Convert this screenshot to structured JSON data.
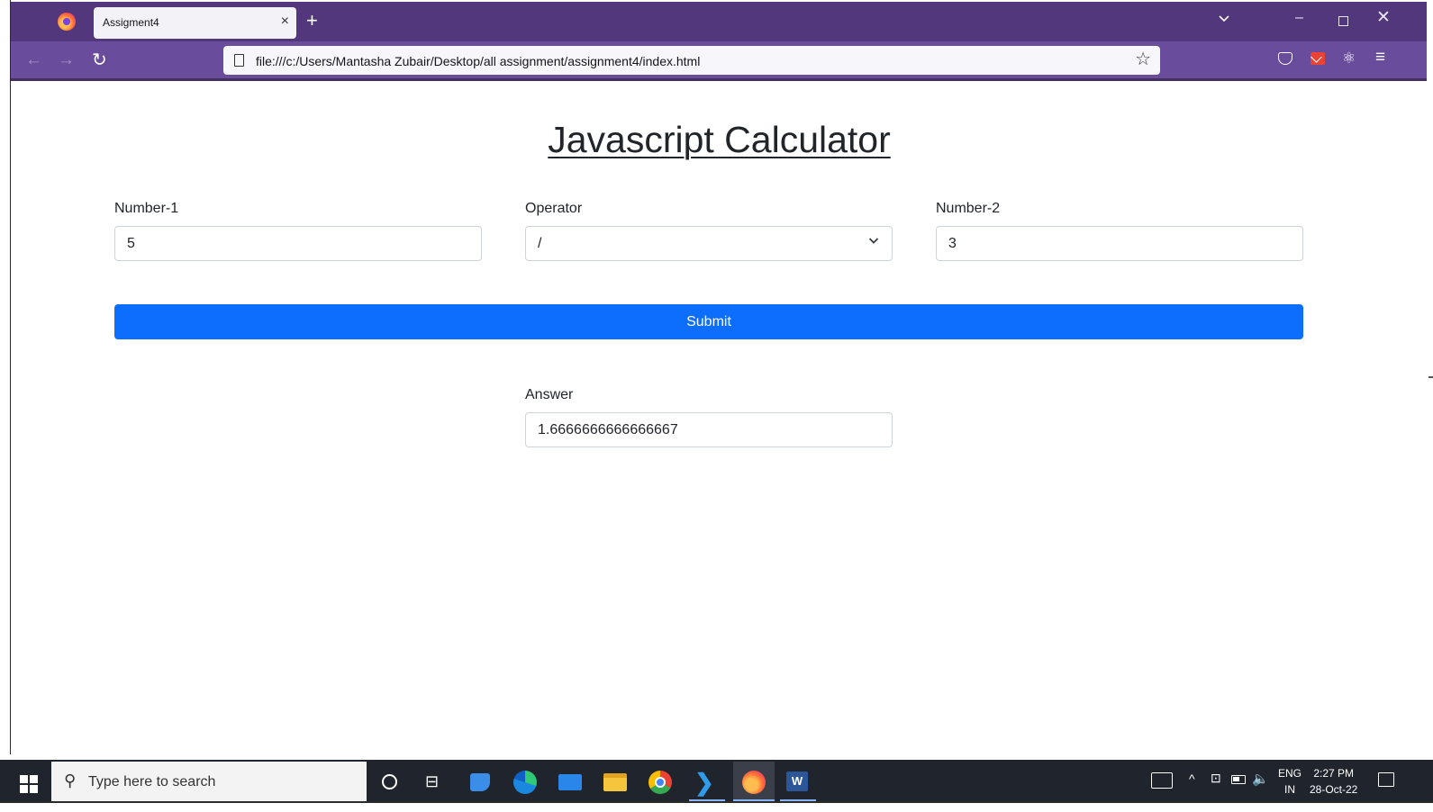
{
  "browser": {
    "tab_title": "Assigment4",
    "tab_close": "×",
    "new_tab": "+",
    "url": "file:///c:/Users/Mantasha Zubair/Desktop/all assignment/assignment4/index.html",
    "icons": [
      "firefox-icon",
      "back-arrow-icon",
      "forward-arrow-icon",
      "reload-icon",
      "page-icon",
      "bookmark-star-icon",
      "pocket-icon",
      "gmail-icon",
      "react-devtools-icon",
      "hamburger-menu-icon"
    ]
  },
  "page": {
    "title": "Javascript Calculator",
    "number1": {
      "label": "Number-1",
      "value": "5"
    },
    "operator": {
      "label": "Operator",
      "value": "/"
    },
    "number2": {
      "label": "Number-2",
      "value": "3"
    },
    "submit_label": "Submit",
    "answer": {
      "label": "Answer",
      "value": "1.6666666666666667"
    },
    "colors": {
      "primary": "#0d6efd",
      "text": "#212529",
      "border": "#ced4da"
    }
  },
  "taskbar": {
    "search_placeholder": "Type here to search",
    "apps": [
      "cortana",
      "task-view",
      "people",
      "edge",
      "mail",
      "file-explorer",
      "chrome",
      "vscode",
      "firefox",
      "word"
    ],
    "tray": {
      "lang_top": "ENG",
      "lang_bottom": "IN",
      "time": "2:27 PM",
      "date": "28-Oct-22"
    }
  },
  "theme": {
    "browser_frame": "#52377c",
    "navbar": "#6a4c9c",
    "taskbar": "#20242c"
  }
}
